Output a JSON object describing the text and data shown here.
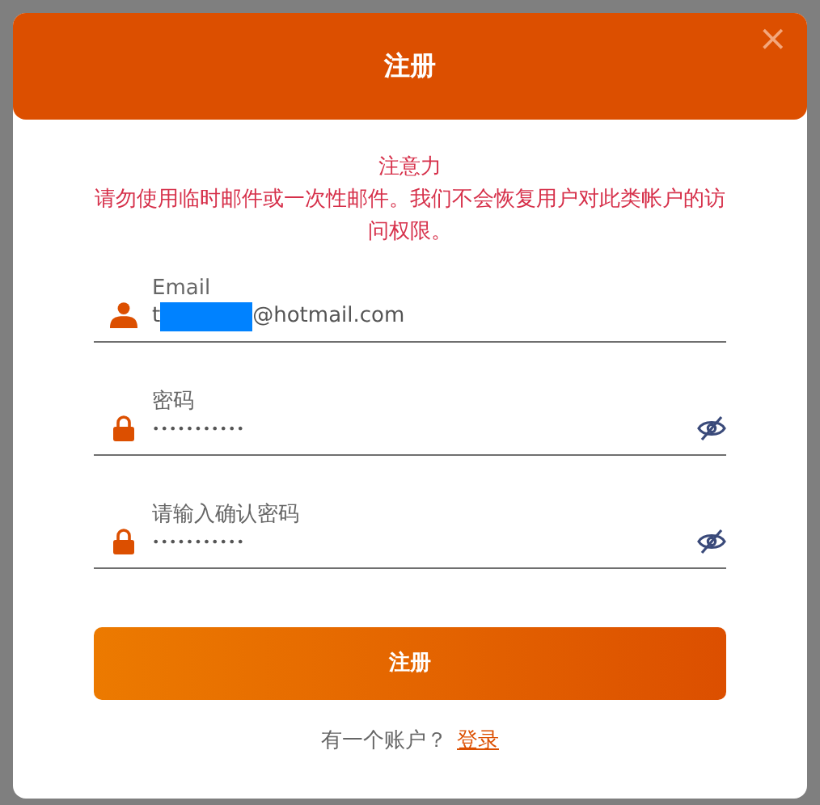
{
  "dialog": {
    "title": "注册",
    "close": "×"
  },
  "notice": {
    "heading": "注意力",
    "text": "请勿使用临时邮件或一次性邮件。我们不会恢复用户对此类帐户的访问权限。"
  },
  "fields": [
    {
      "kind": "email",
      "label": "Email",
      "value_start": "t",
      "redacted": true,
      "value_end": "@hotmail.com"
    },
    {
      "kind": "password",
      "label": "密码",
      "value": "•••••••••••",
      "reveal": true
    },
    {
      "kind": "password",
      "label": "请输入确认密码",
      "value": "•••••••••••",
      "reveal": true
    }
  ],
  "submit": "注册",
  "footer": {
    "text": "有一个账户？",
    "link": "登录"
  }
}
